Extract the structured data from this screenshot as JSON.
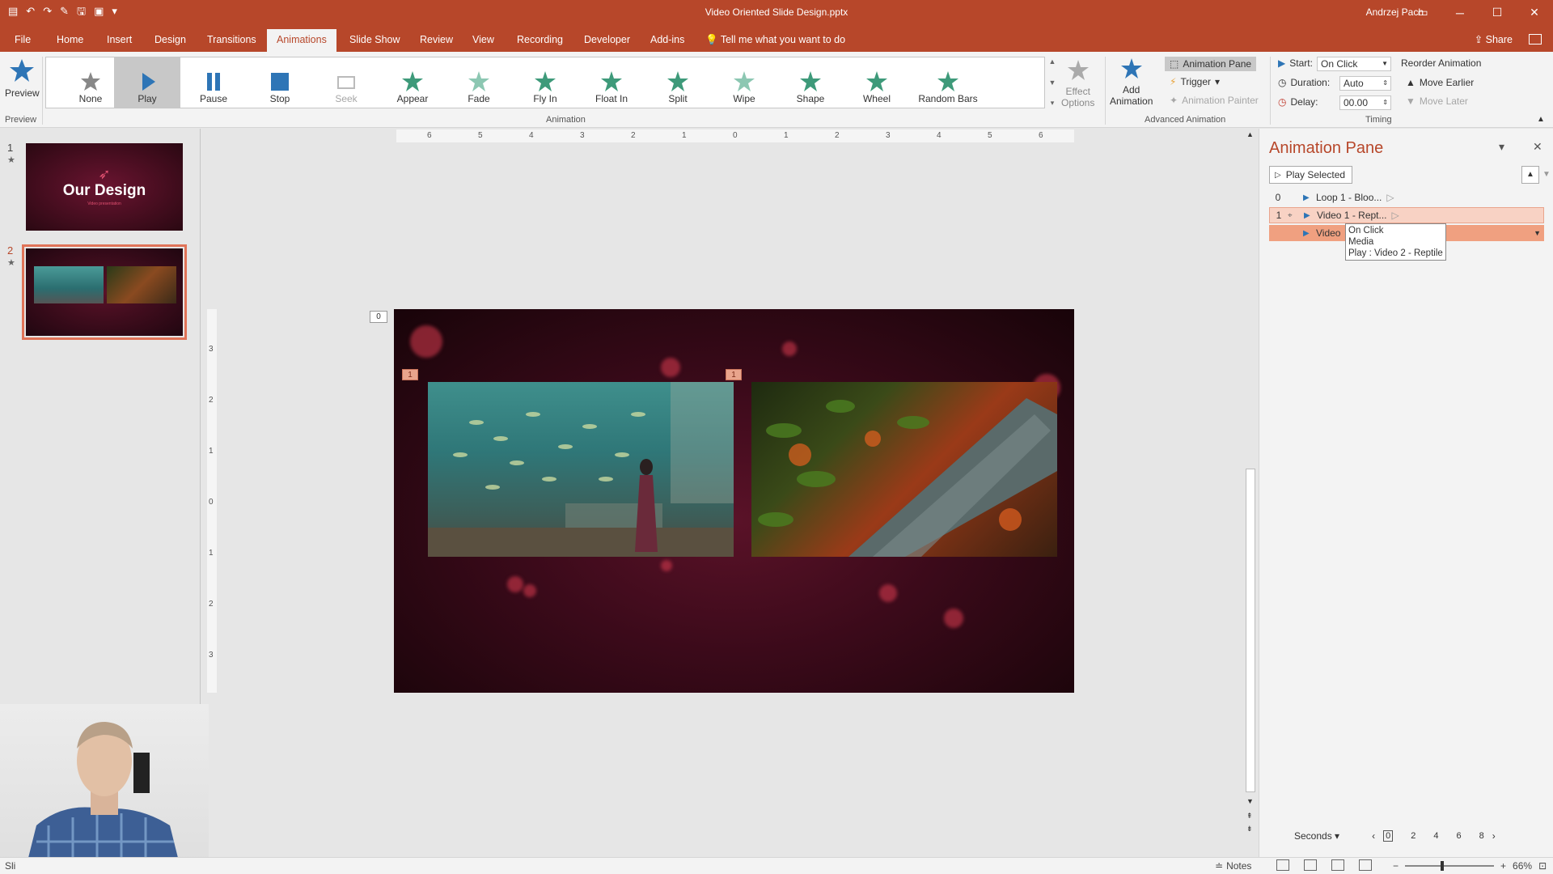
{
  "window": {
    "title": "Video Oriented Slide Design.pptx",
    "user": "Andrzej Pach"
  },
  "tabs": [
    "File",
    "Home",
    "Insert",
    "Design",
    "Transitions",
    "Animations",
    "Slide Show",
    "Review",
    "View",
    "Recording",
    "Developer",
    "Add-ins"
  ],
  "active_tab": "Animations",
  "tell_me": "Tell me what you want to do",
  "share": "Share",
  "ribbon": {
    "preview": {
      "label": "Preview",
      "group": "Preview"
    },
    "gallery": [
      {
        "label": "None",
        "state": "normal"
      },
      {
        "label": "Play",
        "state": "selected"
      },
      {
        "label": "Pause",
        "state": "normal"
      },
      {
        "label": "Stop",
        "state": "normal"
      },
      {
        "label": "Seek",
        "state": "disabled"
      },
      {
        "label": "Appear",
        "state": "normal"
      },
      {
        "label": "Fade",
        "state": "normal"
      },
      {
        "label": "Fly In",
        "state": "normal"
      },
      {
        "label": "Float In",
        "state": "normal"
      },
      {
        "label": "Split",
        "state": "normal"
      },
      {
        "label": "Wipe",
        "state": "normal"
      },
      {
        "label": "Shape",
        "state": "normal"
      },
      {
        "label": "Wheel",
        "state": "normal"
      },
      {
        "label": "Random Bars",
        "state": "normal"
      }
    ],
    "effect_options": {
      "line1": "Effect",
      "line2": "Options"
    },
    "animation_group": "Animation",
    "add_animation": {
      "line1": "Add",
      "line2": "Animation"
    },
    "animation_pane_btn": "Animation Pane",
    "trigger": "Trigger",
    "animation_painter": "Animation Painter",
    "advanced_group": "Advanced Animation",
    "timing": {
      "start_label": "Start:",
      "start_value": "On Click",
      "duration_label": "Duration:",
      "duration_value": "Auto",
      "delay_label": "Delay:",
      "delay_value": "00.00",
      "reorder_title": "Reorder Animation",
      "move_earlier": "Move Earlier",
      "move_later": "Move Later",
      "group": "Timing"
    }
  },
  "slides": [
    {
      "number": "1",
      "title": "Our Design",
      "subtitle": "Video presentation"
    },
    {
      "number": "2"
    }
  ],
  "ruler": {
    "h_labels": [
      "6",
      "5",
      "4",
      "3",
      "2",
      "1",
      "0",
      "1",
      "2",
      "3",
      "4",
      "5",
      "6"
    ],
    "v_labels": [
      "3",
      "2",
      "1",
      "0",
      "1",
      "2",
      "3"
    ]
  },
  "slide_tags": {
    "zero": "0",
    "left": "1",
    "right": "1"
  },
  "animation_pane": {
    "title": "Animation Pane",
    "play_selected": "Play Selected",
    "rows": [
      {
        "index": "0",
        "name": "Loop 1 - Bloo..."
      },
      {
        "index": "1",
        "name": "Video 1 - Rept..."
      },
      {
        "index": "",
        "name": "Video"
      }
    ],
    "tooltip": [
      "On Click",
      "Media",
      "Play : Video 2 - Reptile"
    ],
    "timeline_unit": "Seconds",
    "timeline_ticks": [
      "0",
      "2",
      "4",
      "6",
      "8"
    ]
  },
  "status": {
    "left": "Sli",
    "notes": "Notes",
    "zoom": "66%"
  },
  "colors": {
    "accent": "#b7472a",
    "ribbon_bg": "#f3f3f3",
    "selected_row": "#f8d2c4"
  }
}
